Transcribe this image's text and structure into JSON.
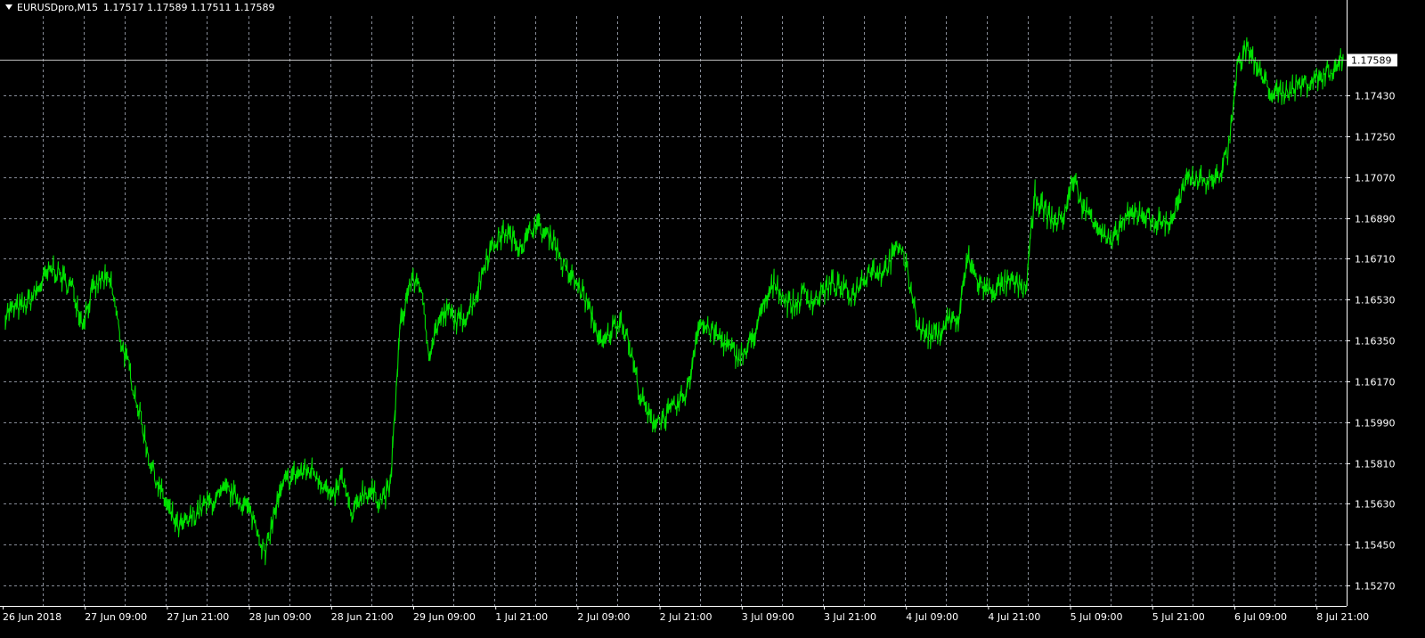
{
  "header": {
    "symbol": "EURUSDpro,M15",
    "ohlc": "1.17517 1.17589 1.17511 1.17589"
  },
  "colors": {
    "background": "#000000",
    "grid": "#c0c8d8",
    "candle": "#00e000",
    "axis_text": "#ffffff",
    "bid_line": "#c0c0c0",
    "price_tag_bg": "#ffffff"
  },
  "chart_data": {
    "type": "line",
    "title": "",
    "xlabel": "",
    "ylabel": "",
    "ylim": [
      1.1518,
      1.1778
    ],
    "grid": true,
    "current_price": 1.17589,
    "current_price_label": "1.17589",
    "y_ticks": [
      1.1743,
      1.1725,
      1.1707,
      1.1689,
      1.1671,
      1.1653,
      1.1635,
      1.1617,
      1.1599,
      1.1581,
      1.1563,
      1.1545,
      1.1527
    ],
    "y_tick_labels": [
      "1.17430",
      "1.17250",
      "1.17070",
      "1.16890",
      "1.16710",
      "1.16530",
      "1.16350",
      "1.16170",
      "1.15990",
      "1.15810",
      "1.15630",
      "1.15450",
      "1.15270"
    ],
    "x_tick_labels": [
      "26 Jun 2018",
      "27 Jun 09:00",
      "27 Jun 21:00",
      "28 Jun 09:00",
      "28 Jun 21:00",
      "29 Jun 09:00",
      "1 Jul 21:00",
      "2 Jul 09:00",
      "2 Jul 21:00",
      "3 Jul 09:00",
      "3 Jul 21:00",
      "4 Jul 09:00",
      "4 Jul 21:00",
      "5 Jul 09:00",
      "5 Jul 21:00",
      "6 Jul 09:00",
      "8 Jul 21:00"
    ],
    "series": [
      {
        "values": [
          1.1647,
          1.1649,
          1.165,
          1.1655,
          1.1662,
          1.1667,
          1.1662,
          1.1658,
          1.1643,
          1.1656,
          1.1662,
          1.166,
          1.1635,
          1.162,
          1.1602,
          1.1582,
          1.157,
          1.156,
          1.1552,
          1.1555,
          1.156,
          1.1563,
          1.1565,
          1.1569,
          1.1566,
          1.1562,
          1.1555,
          1.154,
          1.156,
          1.1572,
          1.1576,
          1.1577,
          1.1578,
          1.1572,
          1.1564,
          1.1575,
          1.1556,
          1.1568,
          1.1568,
          1.1565,
          1.157,
          1.164,
          1.166,
          1.1662,
          1.163,
          1.1643,
          1.1648,
          1.1643,
          1.1647,
          1.1656,
          1.1672,
          1.1679,
          1.1683,
          1.1678,
          1.1678,
          1.1687,
          1.1682,
          1.168,
          1.1667,
          1.1662,
          1.1656,
          1.1645,
          1.1632,
          1.164,
          1.1645,
          1.163,
          1.161,
          1.16,
          1.16,
          1.1603,
          1.1607,
          1.1615,
          1.1643,
          1.164,
          1.1637,
          1.1633,
          1.1628,
          1.163,
          1.164,
          1.1652,
          1.1661,
          1.1653,
          1.165,
          1.1656,
          1.1652,
          1.1657,
          1.166,
          1.1657,
          1.1655,
          1.1662,
          1.1667,
          1.1665,
          1.167,
          1.1678,
          1.166,
          1.164,
          1.1637,
          1.1638,
          1.1645,
          1.1643,
          1.1672,
          1.1661,
          1.1657,
          1.1658,
          1.166,
          1.166,
          1.1657,
          1.1699,
          1.1692,
          1.1687,
          1.169,
          1.1707,
          1.1693,
          1.169,
          1.1682,
          1.1677,
          1.1687,
          1.169,
          1.1692,
          1.1688,
          1.1687,
          1.1687,
          1.1697,
          1.1707,
          1.1707,
          1.1705,
          1.1707,
          1.1717,
          1.1755,
          1.1765,
          1.1755,
          1.1748,
          1.1743,
          1.1745,
          1.1747,
          1.1748,
          1.175,
          1.1752,
          1.1755,
          1.1759
        ]
      }
    ]
  }
}
